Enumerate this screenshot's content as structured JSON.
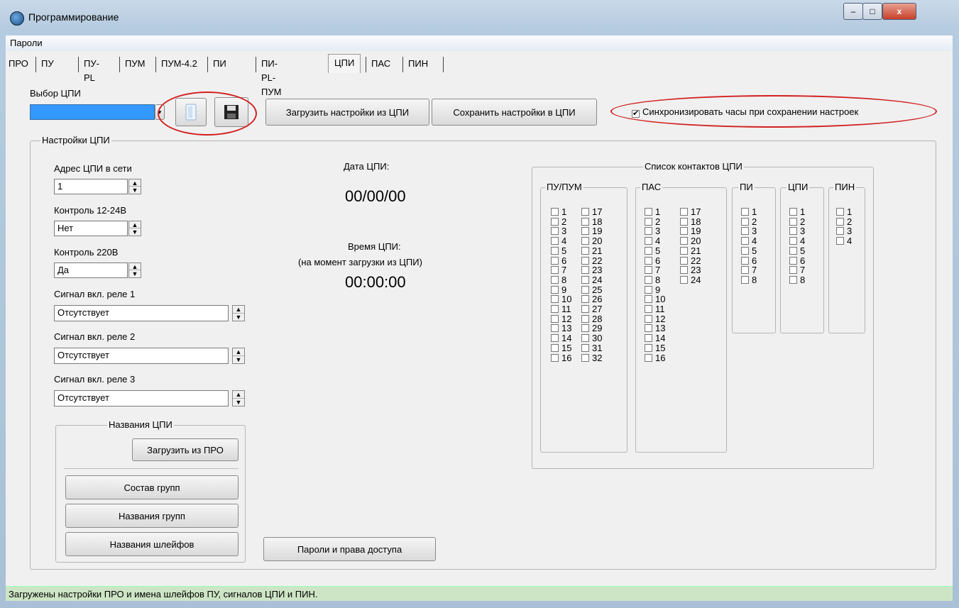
{
  "window": {
    "title": "Программирование",
    "buttons": {
      "minimize": "–",
      "maximize": "□",
      "close": "x"
    }
  },
  "menu": {
    "passwords": "Пароли"
  },
  "tabs": [
    "ПРО",
    "ПУ",
    "ПУ-PL",
    "ПУМ",
    "ПУМ-4.2",
    "ПИ",
    "ПИ-PL-ПУМ",
    "ЦПИ",
    "ПАС",
    "ПИН"
  ],
  "active_tab": "ЦПИ",
  "selector": {
    "label": "Выбор ЦПИ",
    "load_button": "Загрузить настройки из ЦПИ",
    "save_button": "Сохранить настройки в ЦПИ",
    "sync_checkbox": "Синхронизировать часы при сохранении настроек",
    "sync_checked": true
  },
  "settings": {
    "legend": "Настройки ЦПИ",
    "address_label": "Адрес ЦПИ в сети",
    "address_value": "1",
    "ctrl1224_label": "Контроль 12-24В",
    "ctrl1224_value": "Нет",
    "ctrl220_label": "Контроль 220В",
    "ctrl220_value": "Да",
    "relay1_label": "Сигнал вкл. реле 1",
    "relay1_value": "Отсутствует",
    "relay2_label": "Сигнал вкл. реле 2",
    "relay2_value": "Отсутствует",
    "relay3_label": "Сигнал вкл. реле 3",
    "relay3_value": "Отсутствует"
  },
  "names": {
    "legend": "Названия ЦПИ",
    "load_from_pro": "Загрузить из ПРО",
    "groups_composition": "Состав групп",
    "groups_names": "Названия групп",
    "loops_names": "Названия шлейфов"
  },
  "date": {
    "label": "Дата ЦПИ:",
    "value": "00/00/00"
  },
  "time": {
    "label": "Время ЦПИ:",
    "note": "(на момент загрузки из ЦПИ)",
    "value": "00:00:00"
  },
  "passwords_button": "Пароли и права доступа",
  "contacts": {
    "legend": "Список контактов ЦПИ",
    "groups": [
      {
        "name": "ПУ/ПУМ",
        "col1": [
          "1",
          "2",
          "3",
          "4",
          "5",
          "6",
          "7",
          "8",
          "9",
          "10",
          "11",
          "12",
          "13",
          "14",
          "15",
          "16"
        ],
        "col2": [
          "17",
          "18",
          "19",
          "20",
          "21",
          "22",
          "23",
          "24",
          "25",
          "26",
          "27",
          "28",
          "29",
          "30",
          "31",
          "32"
        ]
      },
      {
        "name": "ПАС",
        "col1": [
          "1",
          "2",
          "3",
          "4",
          "5",
          "6",
          "7",
          "8",
          "9",
          "10",
          "11",
          "12",
          "13",
          "14",
          "15",
          "16"
        ],
        "col2": [
          "17",
          "18",
          "19",
          "20",
          "21",
          "22",
          "23",
          "24"
        ]
      },
      {
        "name": "ПИ",
        "col1": [
          "1",
          "2",
          "3",
          "4",
          "5",
          "6",
          "7",
          "8"
        ],
        "col2": []
      },
      {
        "name": "ЦПИ",
        "col1": [
          "1",
          "2",
          "3",
          "4",
          "5",
          "6",
          "7",
          "8"
        ],
        "col2": []
      },
      {
        "name": "ПИН",
        "col1": [
          "1",
          "2",
          "3",
          "4"
        ],
        "col2": []
      }
    ]
  },
  "status": "Загружены настройки ПРО и имена шлейфов ПУ, сигналов ЦПИ и ПИН.",
  "colors": {
    "highlight": "#d32020",
    "selection": "#3399ff",
    "status_bg": "#cde5c5"
  }
}
